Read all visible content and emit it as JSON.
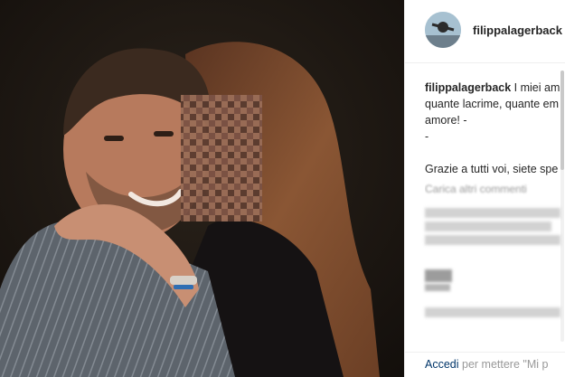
{
  "post": {
    "username": "filippalagerback",
    "caption_lines": [
      "I miei am",
      "quante lacrime, quante em",
      "amore! -",
      "-"
    ],
    "thanks_line": "Grazie a tutti voi, siete spe",
    "load_more": "Carica altri commenti"
  },
  "footer": {
    "login_link": "Accedi",
    "login_rest": " per mettere \"Mi p"
  },
  "colors": {
    "link": "#003569",
    "muted": "#999999",
    "border": "#efefef"
  }
}
